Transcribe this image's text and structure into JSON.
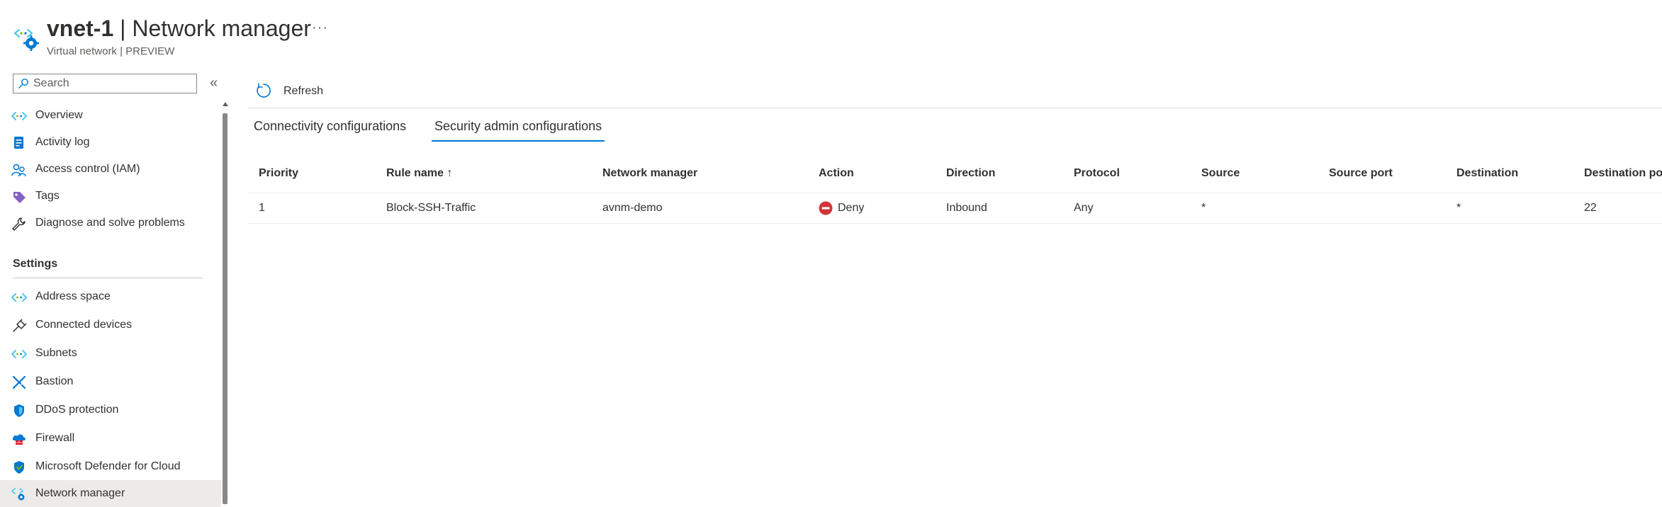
{
  "header": {
    "resource_name": "vnet-1",
    "separator": " | ",
    "page_title": "Network manager",
    "subtitle": "Virtual network | PREVIEW",
    "more": "···"
  },
  "sidebar": {
    "search_placeholder": "Search",
    "collapse": "«",
    "section_settings": "Settings",
    "items_top": [
      {
        "label": "Overview",
        "icon": "vnet-icon"
      },
      {
        "label": "Activity log",
        "icon": "activity-log-icon"
      },
      {
        "label": "Access control (IAM)",
        "icon": "iam-icon"
      },
      {
        "label": "Tags",
        "icon": "tag-icon"
      },
      {
        "label": "Diagnose and solve problems",
        "icon": "wrench-icon"
      }
    ],
    "items_settings": [
      {
        "label": "Address space",
        "icon": "vnet-icon"
      },
      {
        "label": "Connected devices",
        "icon": "plug-icon"
      },
      {
        "label": "Subnets",
        "icon": "vnet-icon"
      },
      {
        "label": "Bastion",
        "icon": "bastion-icon"
      },
      {
        "label": "DDoS protection",
        "icon": "shield-icon"
      },
      {
        "label": "Firewall",
        "icon": "firewall-icon"
      },
      {
        "label": "Microsoft Defender for Cloud",
        "icon": "defender-icon"
      },
      {
        "label": "Network manager",
        "icon": "network-manager-icon",
        "active": true
      }
    ]
  },
  "toolbar": {
    "refresh_label": "Refresh"
  },
  "tabs": [
    {
      "label": "Connectivity configurations",
      "active": false
    },
    {
      "label": "Security admin configurations",
      "active": true
    }
  ],
  "table": {
    "columns": [
      "Priority",
      "Rule name",
      "Network manager",
      "Action",
      "Direction",
      "Protocol",
      "Source",
      "Source port",
      "Destination",
      "Destination po"
    ],
    "sort_indicator": "↑",
    "rows": [
      {
        "priority": "1",
        "rule_name": "Block-SSH-Traffic",
        "network_manager": "avnm-demo",
        "action": "Deny",
        "direction": "Inbound",
        "protocol": "Any",
        "source": "*",
        "source_port": "",
        "destination": "*",
        "destination_port": "22"
      }
    ]
  },
  "colors": {
    "accent": "#0078d4",
    "deny": "#d13438",
    "text": "#323130",
    "active_nav": "#edebe9"
  }
}
